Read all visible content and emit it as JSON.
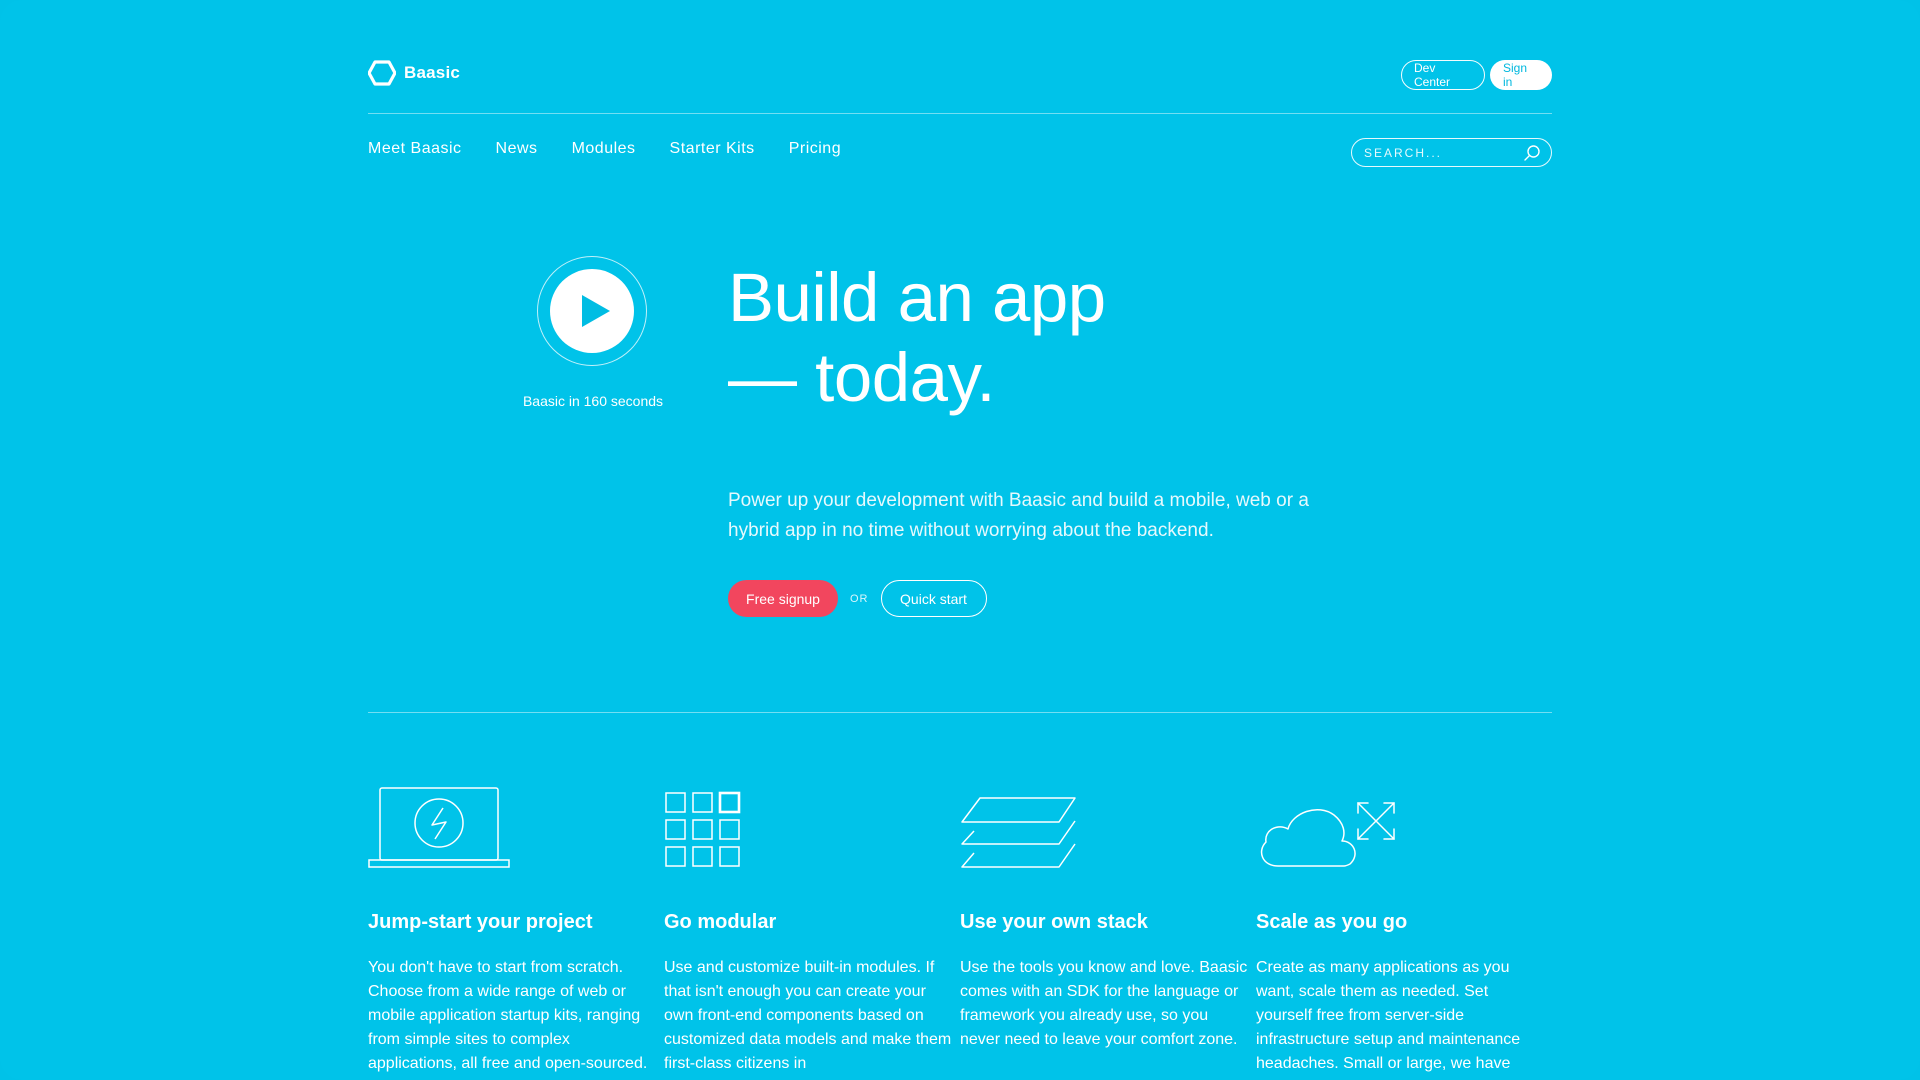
{
  "brand": {
    "name": "Baasic"
  },
  "top_actions": {
    "dev_center": "Dev Center",
    "sign_in": "Sign in"
  },
  "nav": {
    "items": [
      {
        "label": "Meet Baasic"
      },
      {
        "label": "News"
      },
      {
        "label": "Modules"
      },
      {
        "label": "Starter Kits"
      },
      {
        "label": "Pricing"
      }
    ],
    "search_placeholder": "SEARCH..."
  },
  "hero": {
    "video_caption": "Baasic in 160 seconds",
    "headline_line1": "Build an app",
    "headline_line2": "— today.",
    "subtext": "Power up your development with Baasic and build a mobile, web or a hybrid app in no time without worrying about the backend.",
    "signup_label": "Free signup",
    "or_label": "OR",
    "quick_start_label": "Quick start"
  },
  "features": [
    {
      "icon": "laptop-lightning-icon",
      "title": "Jump-start your project",
      "text": "You don't have to start from scratch. Choose from a wide range of web or mobile application startup kits, ranging from simple sites to complex applications, all free and open-sourced."
    },
    {
      "icon": "module-grid-icon",
      "title": "Go modular",
      "text": "Use and customize built-in modules. If that isn't enough you can create your own front-end components based on customized data models and make them first-class citizens in"
    },
    {
      "icon": "stack-layers-icon",
      "title": "Use your own stack",
      "text": "Use the tools you know and love. Baasic comes with an SDK for the language or framework you already use, so you never need to leave your comfort zone."
    },
    {
      "icon": "cloud-scale-icon",
      "title": "Scale as you go",
      "text": "Create as many applications as you want, scale them as needed. Set yourself free from server-side infrastructure setup and maintenance headaches. Small or large, we have"
    }
  ],
  "colors": {
    "background": "#00c3e9",
    "accent_red": "#f2465e",
    "white": "#ffffff"
  }
}
